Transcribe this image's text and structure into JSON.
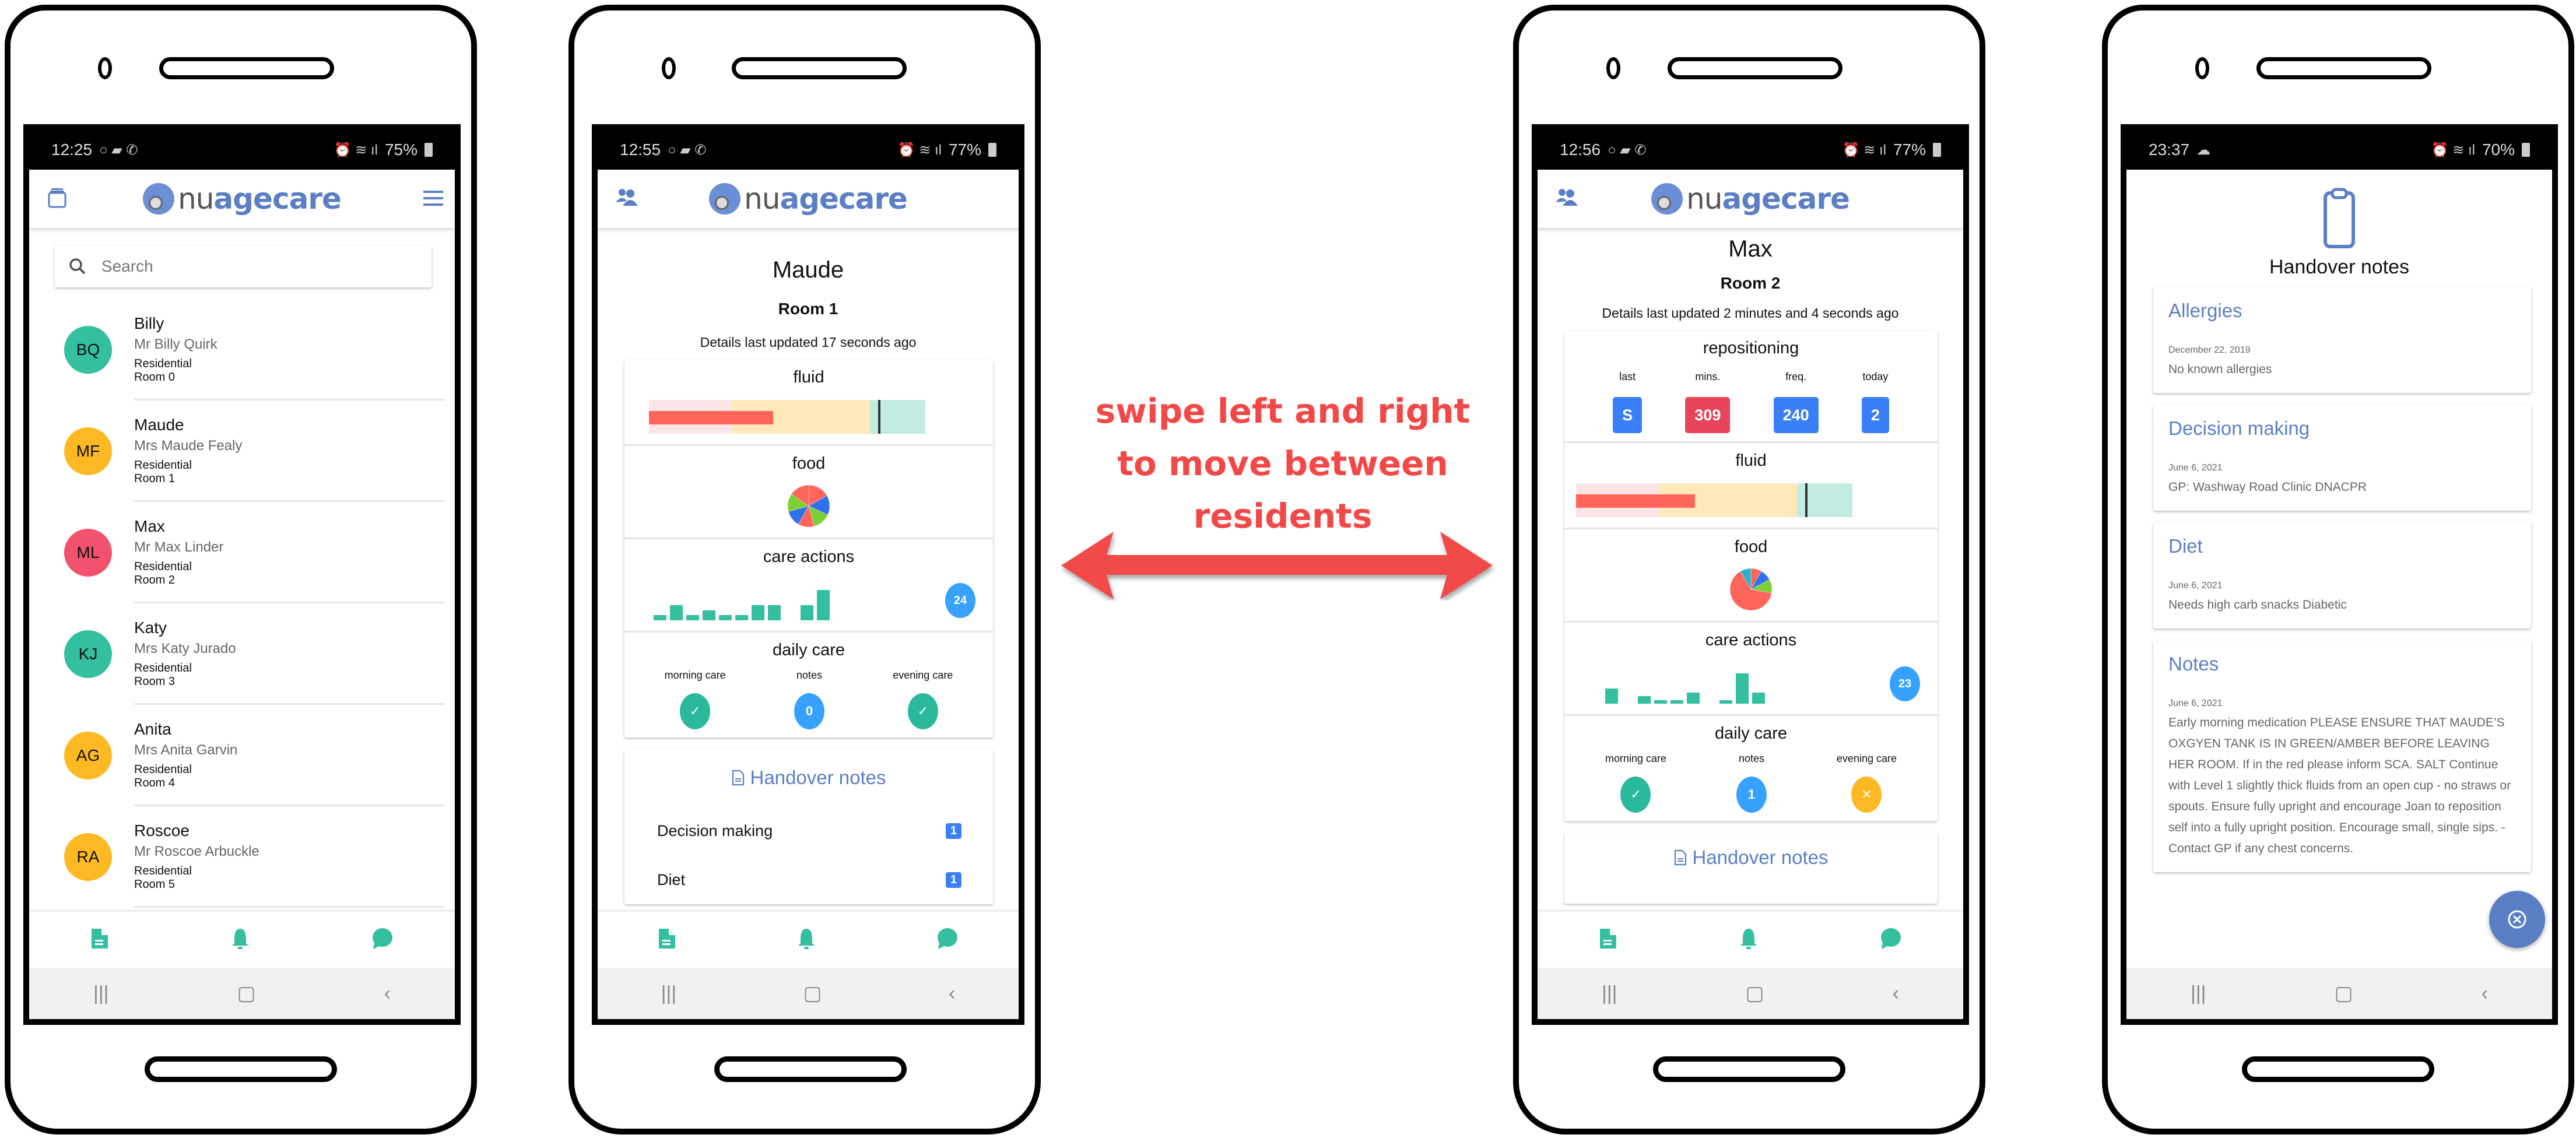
{
  "annotation": {
    "line1": "swipe left and right",
    "line2": "to move between",
    "line3": "residents",
    "color": "#f24848"
  },
  "brand": {
    "name_part1": "nu",
    "name_part2": "agecare",
    "accent": "#5b7fc4",
    "teal": "#35bfa1"
  },
  "bottom_nav": [
    {
      "icon": "document-icon"
    },
    {
      "icon": "bell-icon"
    },
    {
      "icon": "chat-icon"
    }
  ],
  "system_nav": {
    "recents": "|||",
    "home": "▢",
    "back": "‹"
  },
  "phones": [
    {
      "status": {
        "time": "12:25",
        "battery": "75%"
      },
      "screen": "resident-list",
      "search": {
        "placeholder": "Search",
        "value": ""
      },
      "residents": [
        {
          "initials": "BQ",
          "name": "Billy",
          "full_name": "Mr Billy Quirk",
          "type": "Residential",
          "room": "Room 0",
          "color": "#35bfa1"
        },
        {
          "initials": "MF",
          "name": "Maude",
          "full_name": "Mrs Maude Fealy",
          "type": "Residential",
          "room": "Room 1",
          "color": "#fdb924"
        },
        {
          "initials": "ML",
          "name": "Max",
          "full_name": "Mr Max Linder",
          "type": "Residential",
          "room": "Room 2",
          "color": "#f2526e"
        },
        {
          "initials": "KJ",
          "name": "Katy",
          "full_name": "Mrs Katy Jurado",
          "type": "Residential",
          "room": "Room 3",
          "color": "#35bfa1"
        },
        {
          "initials": "AG",
          "name": "Anita",
          "full_name": "Mrs Anita Garvin",
          "type": "Residential",
          "room": "Room 4",
          "color": "#fdb924"
        },
        {
          "initials": "RA",
          "name": "Roscoe",
          "full_name": "Mr Roscoe Arbuckle",
          "type": "Residential",
          "room": "Room 5",
          "color": "#fdb924"
        }
      ]
    },
    {
      "status": {
        "time": "12:55",
        "battery": "77%"
      },
      "screen": "resident-detail",
      "name": "Maude",
      "room": "Room 1",
      "updated": "Details last updated 17 seconds ago",
      "sections": {
        "fluid": "fluid",
        "food": "food",
        "care_actions": "care actions",
        "daily_care": "daily care"
      },
      "fluid": {
        "value_fraction": 0.45,
        "red_zone_end": 0.3,
        "amber_zone_end": 0.8,
        "target_fraction": 0.83,
        "max_fraction": 1.0
      },
      "food_pie": [
        {
          "value": 60,
          "color": "#ff655a"
        },
        {
          "value": 55,
          "color": "#2e72f0"
        },
        {
          "value": 50,
          "color": "#7dcf34"
        },
        {
          "value": 45,
          "color": "#ff655a"
        },
        {
          "value": 45,
          "color": "#2e72f0"
        },
        {
          "value": 50,
          "color": "#7dcf34"
        },
        {
          "value": 55,
          "color": "#ff655a"
        }
      ],
      "care_actions": {
        "bars": [
          1,
          3,
          1,
          2,
          1,
          1,
          3,
          3,
          0,
          3,
          6
        ],
        "total": "24"
      },
      "daily_care": [
        {
          "label": "morning care",
          "value": "✓",
          "color": "#2bb99b"
        },
        {
          "label": "notes",
          "value": "0",
          "color": "#36a1ff"
        },
        {
          "label": "evening care",
          "value": "✓",
          "color": "#2bb99b"
        }
      ],
      "handover": {
        "title": "Handover notes",
        "items": [
          {
            "label": "Decision making",
            "count": "1"
          },
          {
            "label": "Diet",
            "count": "1"
          }
        ]
      }
    },
    {
      "status": {
        "time": "12:56",
        "battery": "77%"
      },
      "screen": "resident-detail",
      "name": "Max",
      "room": "Room 2",
      "updated": "Details last updated 2 minutes and 4 seconds ago",
      "sections": {
        "repositioning": "repositioning",
        "fluid": "fluid",
        "food": "food",
        "care_actions": "care actions",
        "daily_care": "daily care"
      },
      "repositioning": [
        {
          "label": "last",
          "value": "S",
          "color": "#3b7ff6"
        },
        {
          "label": "mins.",
          "value": "309",
          "color": "#e8455c"
        },
        {
          "label": "freq.",
          "value": "240",
          "color": "#3b7ff6"
        },
        {
          "label": "today",
          "value": "2",
          "color": "#3b7ff6"
        }
      ],
      "fluid": {
        "value_fraction": 0.43,
        "red_zone_end": 0.3,
        "amber_zone_end": 0.8,
        "target_fraction": 0.83,
        "max_fraction": 1.0
      },
      "food_pie": [
        {
          "value": 30,
          "color": "#ff655a"
        },
        {
          "value": 32,
          "color": "#2e72f0"
        },
        {
          "value": 38,
          "color": "#7dcf34"
        },
        {
          "value": 230,
          "color": "#ff655a"
        },
        {
          "value": 30,
          "color": "#2ab3c9"
        }
      ],
      "care_actions": {
        "bars": [
          4,
          0,
          2,
          1,
          1,
          3,
          0,
          1,
          8,
          3
        ],
        "total": "23"
      },
      "daily_care": [
        {
          "label": "morning care",
          "value": "✓",
          "color": "#2bb99b"
        },
        {
          "label": "notes",
          "value": "1",
          "color": "#36a1ff"
        },
        {
          "label": "evening care",
          "value": "✕",
          "color": "#fdb924"
        }
      ],
      "handover": {
        "title": "Handover notes",
        "items": []
      }
    },
    {
      "status": {
        "time": "23:37",
        "battery": "70%"
      },
      "screen": "handover-notes",
      "title": "Handover notes",
      "notes": [
        {
          "heading": "Allergies",
          "date": "December 22, 2019",
          "text": "No known allergies"
        },
        {
          "heading": "Decision making",
          "date": "June 6, 2021",
          "text": "GP: Washway Road Clinic DNACPR"
        },
        {
          "heading": "Diet",
          "date": "June 6, 2021",
          "text": "Needs high carb snacks Diabetic"
        },
        {
          "heading": "Notes",
          "date": "June 6, 2021",
          "text": "Early morning medication PLEASE ENSURE THAT MAUDE’S OXGYEN TANK IS IN GREEN/AMBER BEFORE LEAVING HER ROOM. If in the red please inform SCA. SALT Continue with Level 1 slightly thick fluids from an open cup - no straws or spouts. Ensure fully upright and encourage Joan to reposition self into a fully upright position. Encourage small, single sips. - Contact GP if any chest concerns."
        }
      ]
    }
  ]
}
